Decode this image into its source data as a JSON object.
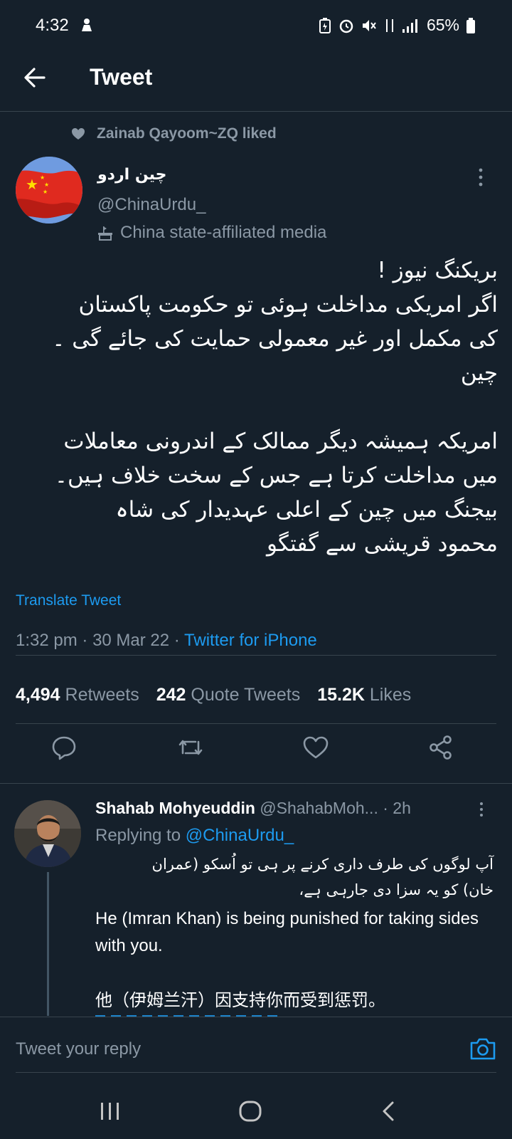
{
  "status_bar": {
    "time": "4:32",
    "battery": "65%"
  },
  "header": {
    "title": "Tweet"
  },
  "social_context": {
    "text": "Zainab Qayoom~ZQ liked"
  },
  "tweet": {
    "author_name": "چین اردو",
    "author_handle": "@ChinaUrdu_",
    "label": "China state-affiliated media",
    "text_lines": [
      "بریکنگ نیوز !",
      "اگر امریکی مداخلت ہوئی تو حکومت پاکستان",
      "کی مکمل اور غیر معمولی حمایت کی جائے گی ۔",
      "چین",
      "",
      "امریکہ ہمیشہ دیگر ممالک کے اندرونی معاملات",
      "میں مداخلت کرتا ہے جس کے سخت خلاف ہیں۔",
      "بیجنگ میں چین کے اعلی عہدیدار کی شاہ",
      "محمود قریشی سے گفتگو"
    ],
    "translate_label": "Translate Tweet",
    "time": "1:32 pm",
    "date": "30 Mar 22",
    "source": "Twitter for iPhone",
    "retweets_count": "4,494",
    "retweets_label": "Retweets",
    "quotes_count": "242",
    "quotes_label": "Quote Tweets",
    "likes_count": "15.2K",
    "likes_label": "Likes"
  },
  "reply": {
    "name": "Shahab Mohyeuddin",
    "handle": "@ShahabMoh...",
    "time": "· 2h",
    "replying_prefix": "Replying to",
    "replying_handle": "@ChinaUrdu_",
    "urdu_lines": [
      "آپ لوگوں کی طرف داری کرنے پر ہی تو اُسکو (عمران",
      "خان) کو یہ سزا دی جارہی ہے،"
    ],
    "english": "He (Imran Khan) is being punished for taking sides with you.",
    "chinese": "他（伊姆兰汗）因支持你而受到惩罚。"
  },
  "reply_box": {
    "placeholder": "Tweet your reply"
  },
  "colors": {
    "background": "#15202b",
    "accent": "#1d9bf0",
    "muted": "#8b98a5",
    "divider": "#38444d"
  }
}
